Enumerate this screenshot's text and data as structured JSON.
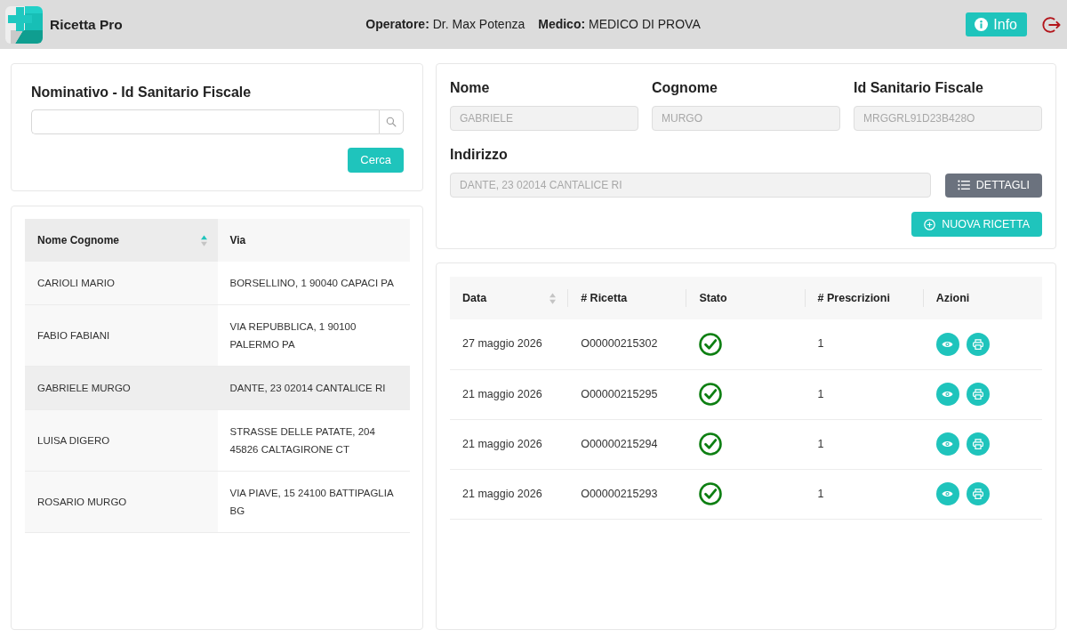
{
  "app": {
    "title": "Ricetta Pro"
  },
  "header": {
    "operator": "**Operatore:** Dr. Max Potenza",
    "doctor": "**Medico:** MEDICO DI PROVA",
    "info_button": "Info"
  },
  "search_panel": {
    "title": "Nominativo - Id Sanitario Fiscale",
    "search_button": "Cerca"
  },
  "patients_table": {
    "columns": [
      {
        "label": "Nome Cognome",
        "sortable": true,
        "sorted": true
      },
      {
        "label": "Via",
        "sortable": false
      }
    ],
    "rows": [
      {
        "name": "CARIOLI MARIO",
        "address": "BORSELLINO, 1 90040 CAPACI PA",
        "selected": false
      },
      {
        "name": "FABIO FABIANI",
        "address": "VIA REPUBBLICA, 1 90100 PALERMO PA",
        "selected": false
      },
      {
        "name": "GABRIELE MURGO",
        "address": "DANTE, 23 02014 CANTALICE RI",
        "selected": true
      },
      {
        "name": "LUISA DIGERO",
        "address": "STRASSE DELLE PATATE, 204 45826 CALTAGIRONE CT",
        "selected": false
      },
      {
        "name": "ROSARIO MURGO",
        "address": "VIA PIAVE, 15 24100 BATTIPAGLIA BG",
        "selected": false
      }
    ]
  },
  "patient": {
    "fields": [
      {
        "label": "Nome",
        "value": "GABRIELE",
        "disabled": true
      },
      {
        "label": "Cognome",
        "value": "MURGO",
        "disabled": true
      },
      {
        "label": "Id Sanitario Fiscale",
        "value": "MRGGRL91D23B428O",
        "disabled": true
      }
    ],
    "address": {
      "label": "Indirizzo",
      "value": "DANTE, 23 02014 CANTALICE RI",
      "disabled": true
    },
    "details_button": "DETTAGLI",
    "new_prescription_button": "NUOVA RICETTA"
  },
  "prescriptions_table": {
    "columns": [
      {
        "label": "Data",
        "sortable": true,
        "sorted": false
      },
      {
        "label": "# Ricetta",
        "sortable": false
      },
      {
        "label": "Stato",
        "sortable": false
      },
      {
        "label": "# Prescrizioni",
        "sortable": false
      },
      {
        "label": "Azioni",
        "sortable": false
      }
    ],
    "rows": [
      {
        "date": "27 maggio 2026",
        "number": "O00000215302",
        "completed": true,
        "count": "1"
      },
      {
        "date": "21 maggio 2026",
        "number": "O00000215295",
        "completed": true,
        "count": "1"
      },
      {
        "date": "21 maggio 2026",
        "number": "O00000215294",
        "completed": true,
        "count": "1"
      },
      {
        "date": "21 maggio 2026",
        "number": "O00000215293",
        "completed": true,
        "count": "1"
      }
    ]
  }
}
